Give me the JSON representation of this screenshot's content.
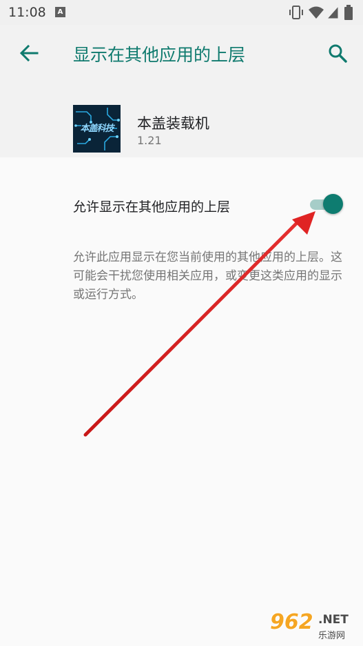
{
  "status_bar": {
    "time": "11:08",
    "notification_icon_letter": "A",
    "icons": [
      "a-notification-icon",
      "vibrate-icon",
      "wifi-icon",
      "signal-icon",
      "battery-icon"
    ]
  },
  "app_bar": {
    "title": "显示在其他应用的上层",
    "back_icon": "arrow-back-icon",
    "search_icon": "search-icon"
  },
  "app_info": {
    "name": "本盖装载机",
    "version": "1.21",
    "icon_text": "本盖科技"
  },
  "setting": {
    "label": "允许显示在其他应用的上层",
    "enabled": true
  },
  "description": "允许此应用显示在您当前使用的其他应用的上层。这可能会干扰您使用相关应用，或变更这类应用的显示或运行方式。",
  "watermark": {
    "number": "962",
    "domain": ".NET",
    "chinese": "乐游网"
  },
  "colors": {
    "accent": "#0f7a6e",
    "toggle_thumb": "#0e7c70",
    "toggle_track": "#a6cdc8",
    "annotation_arrow": "#e02424"
  }
}
